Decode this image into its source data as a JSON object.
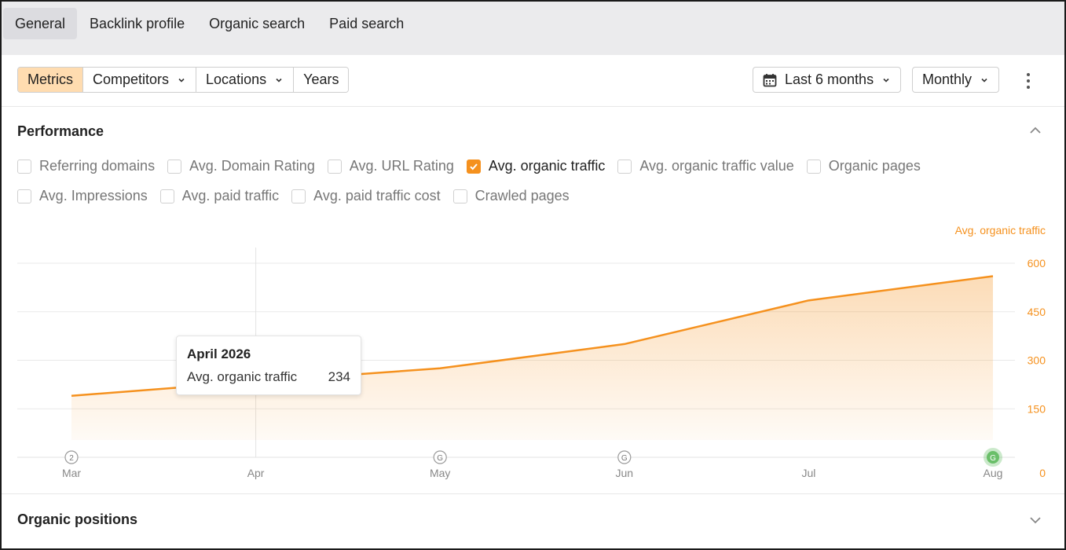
{
  "tabs": [
    {
      "label": "General",
      "active": true
    },
    {
      "label": "Backlink profile",
      "active": false
    },
    {
      "label": "Organic search",
      "active": false
    },
    {
      "label": "Paid search",
      "active": false
    }
  ],
  "toolbar": {
    "segments": [
      {
        "label": "Metrics",
        "active": true,
        "dropdown": false
      },
      {
        "label": "Competitors",
        "active": false,
        "dropdown": true
      },
      {
        "label": "Locations",
        "active": false,
        "dropdown": true
      },
      {
        "label": "Years",
        "active": false,
        "dropdown": false
      }
    ],
    "date_range": "Last 6 months",
    "interval": "Monthly",
    "calendar_icon": "calendar-icon",
    "more_icon": "kebab-menu-icon"
  },
  "performance": {
    "title": "Performance",
    "checkbox_rows": [
      [
        {
          "label": "Referring domains",
          "checked": false
        },
        {
          "label": "Avg. Domain Rating",
          "checked": false
        },
        {
          "label": "Avg. URL Rating",
          "checked": false
        },
        {
          "label": "Avg. organic traffic",
          "checked": true
        },
        {
          "label": "Avg. organic traffic value",
          "checked": false
        },
        {
          "label": "Organic pages",
          "checked": false
        }
      ],
      [
        {
          "label": "Avg. Impressions",
          "checked": false
        },
        {
          "label": "Avg. paid traffic",
          "checked": false
        },
        {
          "label": "Avg. paid traffic cost",
          "checked": false
        },
        {
          "label": "Crawled pages",
          "checked": false
        }
      ]
    ]
  },
  "chart_data": {
    "type": "area",
    "x": [
      "Mar",
      "Apr",
      "May",
      "Jun",
      "Jul",
      "Aug"
    ],
    "series": [
      {
        "name": "Avg. organic traffic",
        "values": [
          190,
          234,
          275,
          350,
          485,
          560
        ],
        "color": "#f5911e"
      }
    ],
    "ylabel": "Avg. organic traffic",
    "yticks": [
      0,
      150,
      300,
      450,
      600
    ],
    "ylim": [
      0,
      600
    ],
    "y_axis_side": "right",
    "grid": true,
    "markers": [
      {
        "x": "Mar",
        "label": "2",
        "highlight": false
      },
      {
        "x": "May",
        "label": "G",
        "highlight": false
      },
      {
        "x": "Jun",
        "label": "G",
        "highlight": false
      },
      {
        "x": "Aug",
        "label": "G",
        "highlight": true
      }
    ],
    "hover": {
      "x": "Apr"
    },
    "tooltip": {
      "title": "April 2026",
      "metric": "Avg. organic traffic",
      "value": "234"
    }
  },
  "organic_positions": {
    "title": "Organic positions"
  },
  "colors": {
    "accent": "#f5911e",
    "active_segment": "#ffdcb0",
    "marker_green": "#6abf69"
  }
}
